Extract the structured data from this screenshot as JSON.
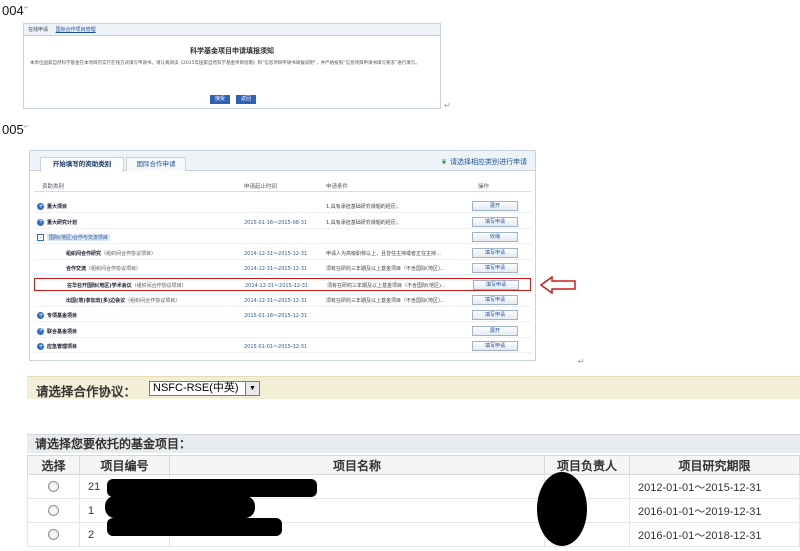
{
  "steps": {
    "s004": "004",
    "s005": "005",
    "mark": "↵"
  },
  "panel004": {
    "tabs": [
      "在线申请",
      "国际合作项目管理"
    ],
    "title": "科学基金项目申请填报须知",
    "text": "本单位国家自然科学基金在本项目内实行在线方式填写申请书，请认真阅读《2015年国家自然科学基金项目指南》和“信息项目申请书填报说明”，并严格按照“信息项目申请书填写要求”进行填写。",
    "btn_agree": "接受",
    "btn_back": "返回"
  },
  "panel005": {
    "tabs": [
      "开始填写的资助类别",
      "国际合作申请"
    ],
    "hint": "请选择相应类别进行申请",
    "columns": [
      "资助类别",
      "申请起止时间",
      "申请条件",
      "操作"
    ],
    "rows": [
      {
        "name": "重大项目",
        "sub": false,
        "icon": "plus",
        "date": "",
        "cond": "1.具有承担基础研究课题的经历；",
        "action": "展开"
      },
      {
        "name": "重大研究计划",
        "sub": false,
        "icon": "plus",
        "date": "2015-01-16～2015-08-31",
        "cond": "1.具有承担基础研究课题的经历；",
        "action": "填写申请"
      },
      {
        "name": "国际(地区)合作与交流项目",
        "sub": false,
        "icon": "minus",
        "date": "",
        "cond": "",
        "action": "收缩",
        "intl": true
      },
      {
        "name": "组织间合作研究",
        "note": "（组织间合作协议项目）",
        "sub": true,
        "date": "2014-12-31～2015-12-31",
        "cond": "申请人为高级职称以上，且曾任主持或者正在主持…",
        "action": "填写申请"
      },
      {
        "name": "合作交流",
        "note": "（组织间合作协议项目）",
        "sub": true,
        "date": "2014-12-31～2015-12-31",
        "cond": "须有在研的三年期及以上基金项目（不含国际(地区)…",
        "action": "填写申请"
      },
      {
        "name": "在华召开国际(地区)学术会议",
        "note": "（组织间合作协议项目）",
        "sub": true,
        "date": "2014-12-31～2015-12-31",
        "cond": "须有在研的三年期及以上基金项目（不含国际(地区)…",
        "action": "填写申请",
        "highlight": true
      },
      {
        "name": "出国(境)参加双(多)边会议",
        "note": "（组织间合作协议项目）",
        "sub": true,
        "date": "2014-12-31～2015-12-31",
        "cond": "须有在研的三年期及以上基金项目（不含国际(地区)…",
        "action": "填写申请"
      },
      {
        "name": "专项基金项目",
        "sub": false,
        "icon": "plus",
        "date": "2015-01-16～2015-12-31",
        "cond": "",
        "action": "填写申请"
      },
      {
        "name": "联合基金项目",
        "sub": false,
        "icon": "plus",
        "date": "",
        "cond": "",
        "action": "展开"
      },
      {
        "name": "应急管理项目",
        "sub": false,
        "icon": "plus",
        "date": "2015-01-01～2015-12-31",
        "cond": "",
        "action": "填写申请"
      }
    ]
  },
  "protocol": {
    "label": "请选择合作协议：",
    "selected": "NSFC-RSE(中英)",
    "arrow": "▼"
  },
  "projects": {
    "caption": "请选择您要依托的基金项目：",
    "columns": [
      "选择",
      "项目编号",
      "项目名称",
      "项目负责人",
      "项目研究期限"
    ],
    "rows": [
      {
        "number": "21",
        "name": "",
        "leader": "",
        "period": "2012-01-01～2015-12-31"
      },
      {
        "number": "1",
        "name": "",
        "leader": "",
        "period": "2016-01-01～2019-12-31"
      },
      {
        "number": "2",
        "name": "",
        "leader": "",
        "period": "2016-01-01～2018-12-31"
      }
    ]
  },
  "colors": {
    "highlight": "#d21a1a",
    "link": "#1a4f9c",
    "accent": "#2c6cc4"
  }
}
